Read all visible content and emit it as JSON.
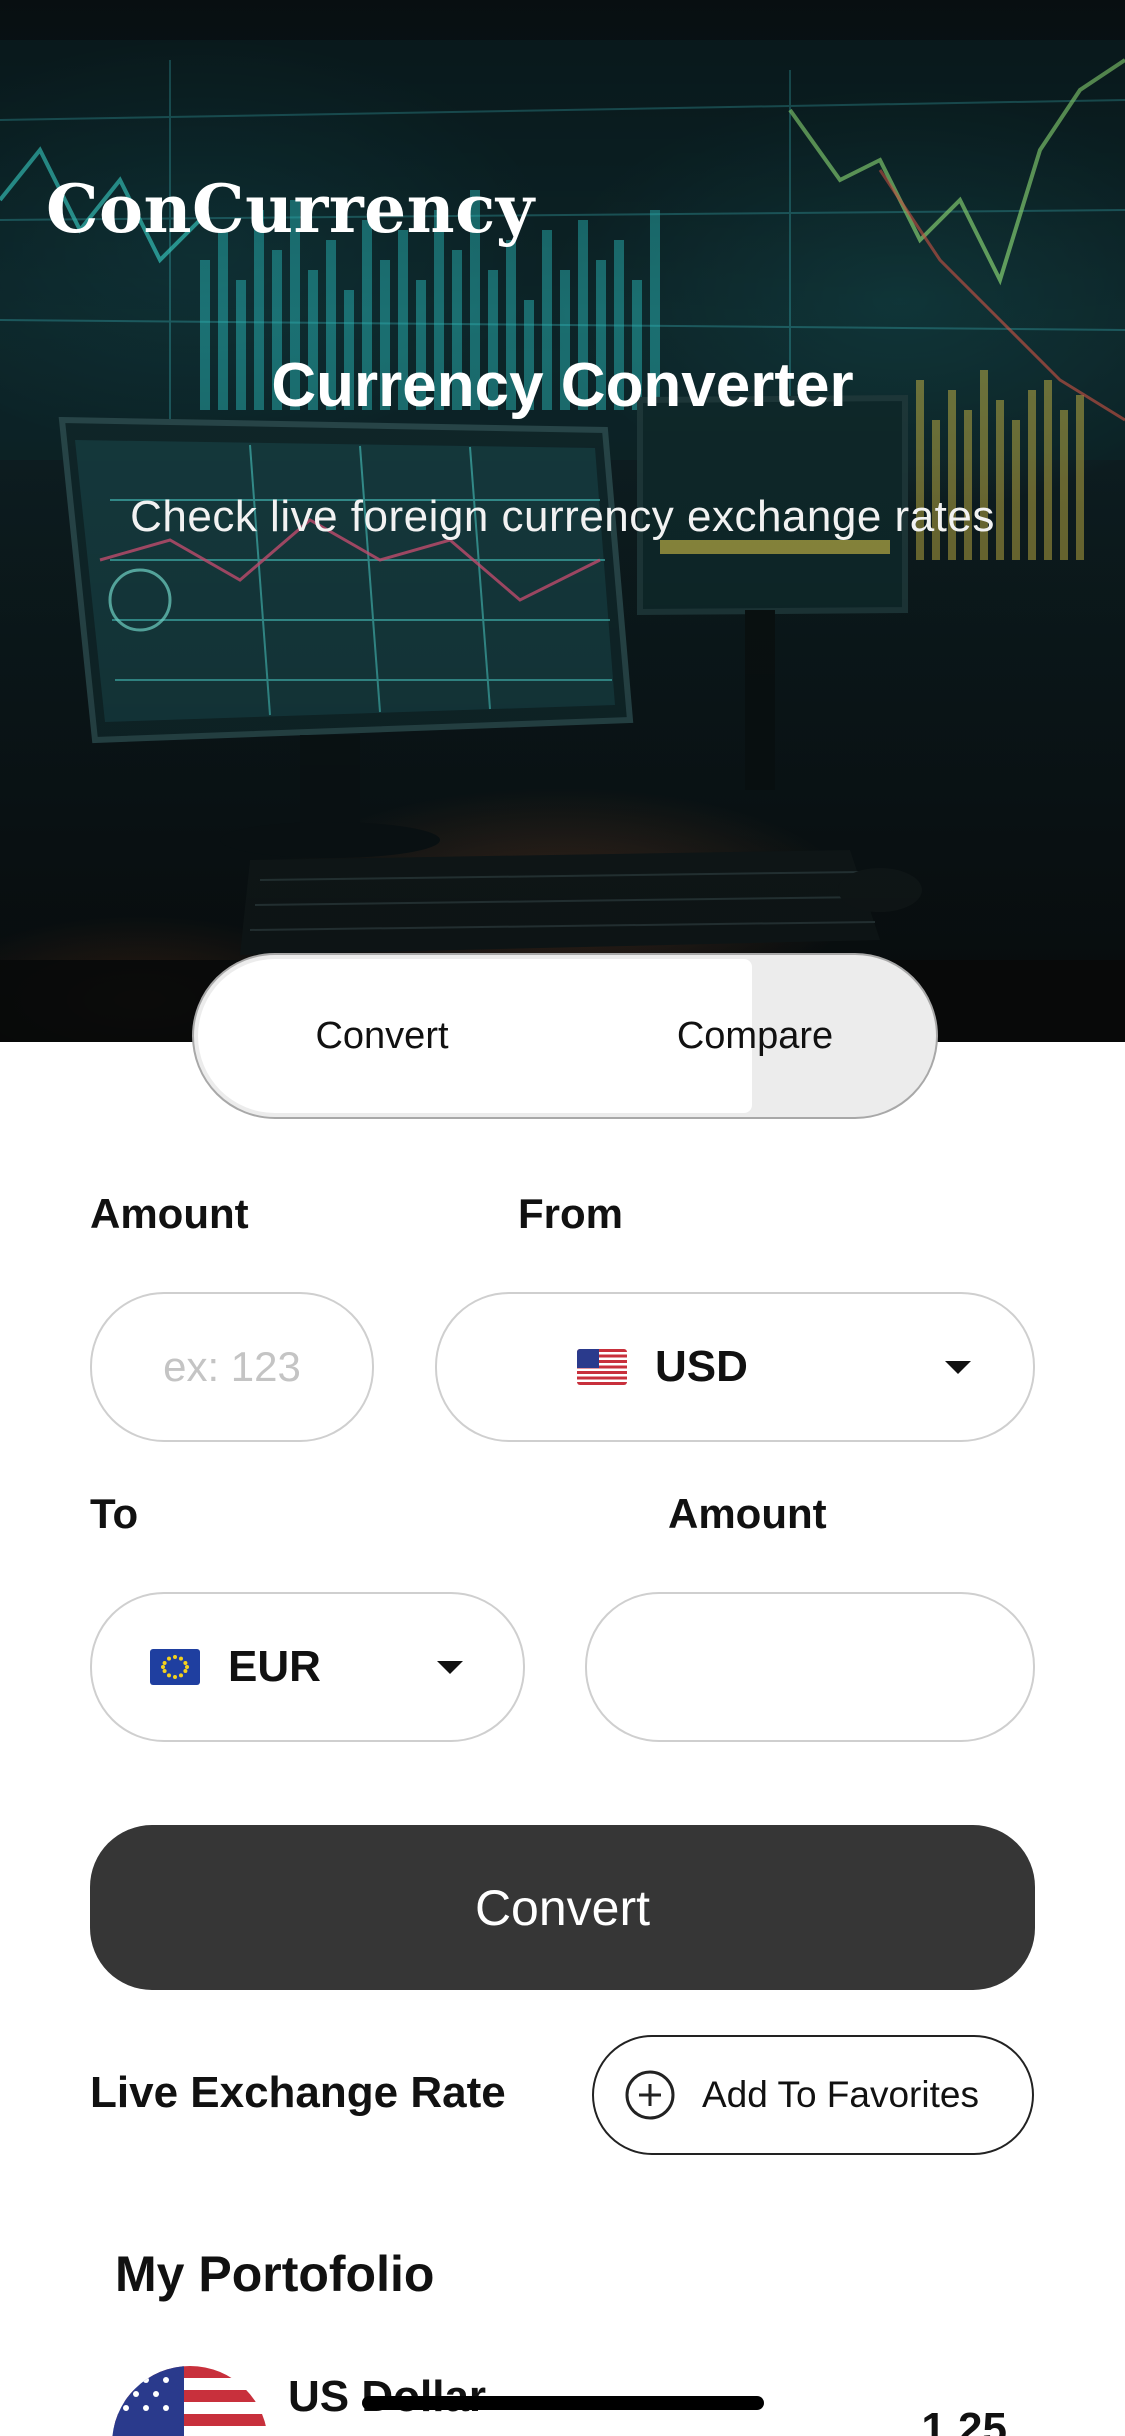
{
  "hero": {
    "brand": "ConCurrency",
    "title": "Currency Converter",
    "subtitle": "Check live foreign currency exchange rates"
  },
  "tabs": [
    {
      "label": "Convert",
      "active": true
    },
    {
      "label": "Compare",
      "active": false
    }
  ],
  "form": {
    "amount_label": "Amount",
    "amount_placeholder": "ex: 123",
    "amount_value": "",
    "from_label": "From",
    "from_currency": "USD",
    "from_flag": "us-flag-icon",
    "to_label": "To",
    "to_currency": "EUR",
    "to_flag": "eu-flag-icon",
    "result_label": "Amount",
    "result_value": ""
  },
  "actions": {
    "convert_label": "Convert",
    "live_rate_label": "Live Exchange Rate",
    "favorites_label": "Add To Favorites",
    "favorites_icon": "plus-circle-icon"
  },
  "portfolio": {
    "title": "My Portofolio",
    "items": [
      {
        "name": "US Dollar",
        "rate": "1.25",
        "flag": "us-flag-icon"
      }
    ]
  },
  "colors": {
    "button_dark": "#363636",
    "segment_bg": "#ececec",
    "field_border": "#cfcfcf"
  }
}
